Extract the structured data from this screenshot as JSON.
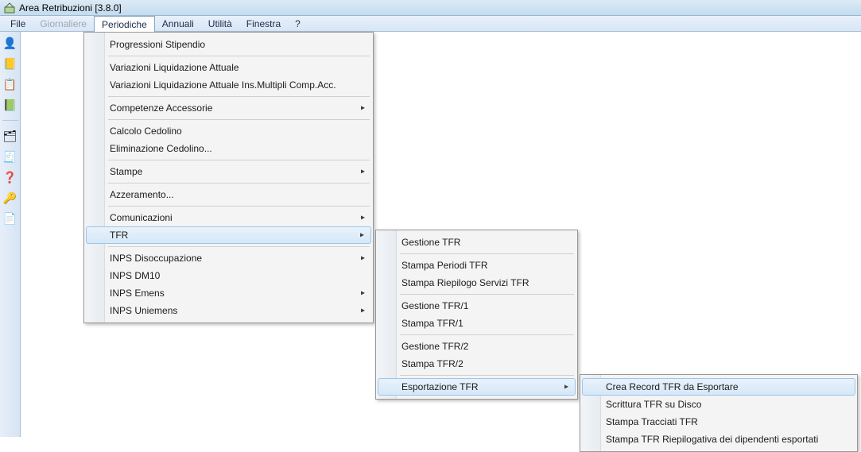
{
  "window": {
    "title": "Area Retribuzioni [3.8.0]"
  },
  "menubar": {
    "file": "File",
    "giornaliere": "Giornaliere",
    "periodiche": "Periodiche",
    "annuali": "Annuali",
    "utilita": "Utilità",
    "finestra": "Finestra",
    "help": "?"
  },
  "menu_periodiche": {
    "progressioni": "Progressioni Stipendio",
    "var_liq": "Variazioni Liquidazione Attuale",
    "var_liq_multi": "Variazioni Liquidazione Attuale Ins.Multipli Comp.Acc.",
    "competenze": "Competenze Accessorie",
    "calcolo": "Calcolo Cedolino",
    "eliminazione": "Eliminazione Cedolino...",
    "stampe": "Stampe",
    "azzeramento": "Azzeramento...",
    "comunicazioni": "Comunicazioni",
    "tfr": "TFR",
    "inps_dis": "INPS Disoccupazione",
    "inps_dm10": "INPS DM10",
    "inps_emens": "INPS Emens",
    "inps_uniemens": "INPS Uniemens"
  },
  "menu_tfr": {
    "gestione": "Gestione TFR",
    "stampa_periodi": "Stampa Periodi TFR",
    "stampa_riepilogo": "Stampa Riepilogo Servizi TFR",
    "gestione1": "Gestione TFR/1",
    "stampa1": "Stampa TFR/1",
    "gestione2": "Gestione TFR/2",
    "stampa2": "Stampa TFR/2",
    "esportazione": "Esportazione TFR"
  },
  "menu_export": {
    "crea": "Crea Record TFR da Esportare",
    "scrittura": "Scrittura TFR su Disco",
    "stampa_tracciati": "Stampa Tracciati TFR",
    "stampa_riepilogativa": "Stampa TFR Riepilogativa dei dipendenti esportati"
  },
  "toolbar_icons": {
    "i1": "👤",
    "i2": "📒",
    "i3": "📋",
    "i4": "📗",
    "i5": "🗂",
    "i6": "🧾",
    "i7": "❓",
    "i8": "🔑",
    "i9": "📄"
  }
}
